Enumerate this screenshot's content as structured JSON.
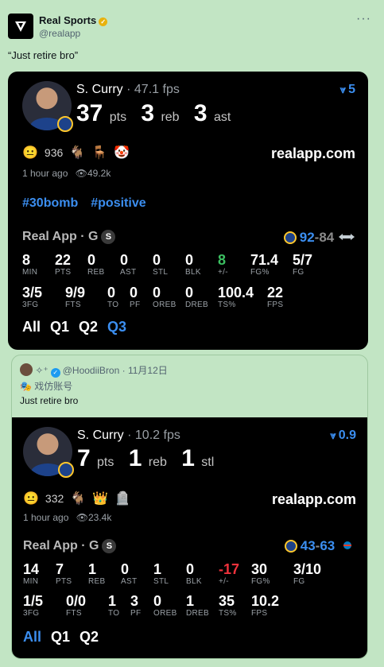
{
  "author": {
    "name": "Real Sports",
    "handle": "@realapp"
  },
  "tweet": {
    "text": "“Just retire bro”"
  },
  "card1": {
    "player": "S. Curry",
    "fps": "47.1 fps",
    "rank": "5",
    "stat1": {
      "value": "37",
      "unit": "pts"
    },
    "stat2": {
      "value": "3",
      "unit": "reb"
    },
    "stat3": {
      "value": "3",
      "unit": "ast"
    },
    "reaction_count": "936",
    "site": "realapp.com",
    "time": "1 hour ago",
    "views": "49.2k",
    "hashtags": [
      "#30bomb",
      "#positive"
    ],
    "league": "Real App · G",
    "league_badge": "S",
    "score_team": "92",
    "score_opp": "84",
    "row1": [
      {
        "v": "8",
        "l": "MIN"
      },
      {
        "v": "22",
        "l": "PTS"
      },
      {
        "v": "0",
        "l": "REB"
      },
      {
        "v": "0",
        "l": "AST"
      },
      {
        "v": "0",
        "l": "STL"
      },
      {
        "v": "0",
        "l": "BLK"
      },
      {
        "v": "8",
        "l": "+/-"
      },
      {
        "v": "71.4",
        "l": "FG%"
      },
      {
        "v": "5/7",
        "l": "FG"
      }
    ],
    "row2": [
      {
        "v": "3/5",
        "l": "3FG"
      },
      {
        "v": "9/9",
        "l": "FTS"
      },
      {
        "v": "0",
        "l": "TO"
      },
      {
        "v": "0",
        "l": "PF"
      },
      {
        "v": "0",
        "l": "OREB"
      },
      {
        "v": "0",
        "l": "DREB"
      },
      {
        "v": "100.4",
        "l": "TS%"
      },
      {
        "v": "22",
        "l": "FPS"
      }
    ],
    "tabs": [
      "All",
      "Q1",
      "Q2",
      "Q3"
    ]
  },
  "quote": {
    "name": "@HoodiiBron",
    "date": "· 11月12日",
    "sub": "戏仿账号",
    "text": "Just retire bro"
  },
  "card2": {
    "player": "S. Curry",
    "fps": "10.2 fps",
    "rank": "0.9",
    "stat1": {
      "value": "7",
      "unit": "pts"
    },
    "stat2": {
      "value": "1",
      "unit": "reb"
    },
    "stat3": {
      "value": "1",
      "unit": "stl"
    },
    "reaction_count": "332",
    "site": "realapp.com",
    "time": "1 hour ago",
    "views": "23.4k",
    "league": "Real App · G",
    "league_badge": "S",
    "score_team": "43",
    "score_opp": "63",
    "row1": [
      {
        "v": "14",
        "l": "MIN"
      },
      {
        "v": "7",
        "l": "PTS"
      },
      {
        "v": "1",
        "l": "REB"
      },
      {
        "v": "0",
        "l": "AST"
      },
      {
        "v": "1",
        "l": "STL"
      },
      {
        "v": "0",
        "l": "BLK"
      },
      {
        "v": "-17",
        "l": "+/-"
      },
      {
        "v": "30",
        "l": "FG%"
      },
      {
        "v": "3/10",
        "l": "FG"
      }
    ],
    "row2": [
      {
        "v": "1/5",
        "l": "3FG"
      },
      {
        "v": "0/0",
        "l": "FTS"
      },
      {
        "v": "1",
        "l": "TO"
      },
      {
        "v": "3",
        "l": "PF"
      },
      {
        "v": "0",
        "l": "OREB"
      },
      {
        "v": "1",
        "l": "DREB"
      },
      {
        "v": "35",
        "l": "TS%"
      },
      {
        "v": "10.2",
        "l": "FPS"
      }
    ],
    "tabs": [
      "All",
      "Q1",
      "Q2"
    ]
  },
  "colors": {
    "accent": "#3b8ef0",
    "positive": "#3cbf61",
    "negative": "#f0323c",
    "page_bg": "#c2e5c4"
  }
}
